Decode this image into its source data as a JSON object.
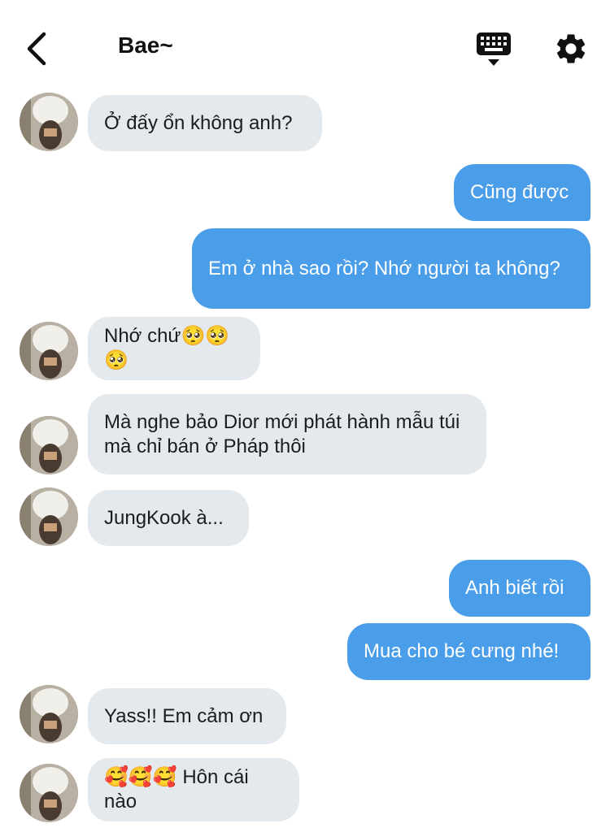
{
  "header": {
    "contact_name": "Bae~",
    "back_icon": "chevron-left-icon",
    "keyboard_icon": "keyboard-icon",
    "settings_icon": "gear-icon"
  },
  "colors": {
    "incoming_bubble": "#e4e9ee",
    "outgoing_bubble": "#4a9de8",
    "outgoing_text": "#ffffff",
    "incoming_text": "#1c1c1c"
  },
  "messages": [
    {
      "sender": "them",
      "text": "Ở đấy ổn không anh?"
    },
    {
      "sender": "me",
      "text": "Cũng được"
    },
    {
      "sender": "me",
      "text": "Em ở nhà sao rồi? Nhớ người ta không?"
    },
    {
      "sender": "them",
      "text": "Nhớ chứ🥺🥺🥺"
    },
    {
      "sender": "them",
      "text": "Mà nghe bảo Dior mới phát hành mẫu túi mà chỉ bán ở Pháp thôi"
    },
    {
      "sender": "them",
      "text": "JungKook à..."
    },
    {
      "sender": "me",
      "text": "Anh biết rồi"
    },
    {
      "sender": "me",
      "text": "Mua cho bé cưng nhé!"
    },
    {
      "sender": "them",
      "text": "Yass!! Em cảm ơn"
    },
    {
      "sender": "them",
      "text": "🥰🥰🥰 Hôn cái nào"
    }
  ]
}
